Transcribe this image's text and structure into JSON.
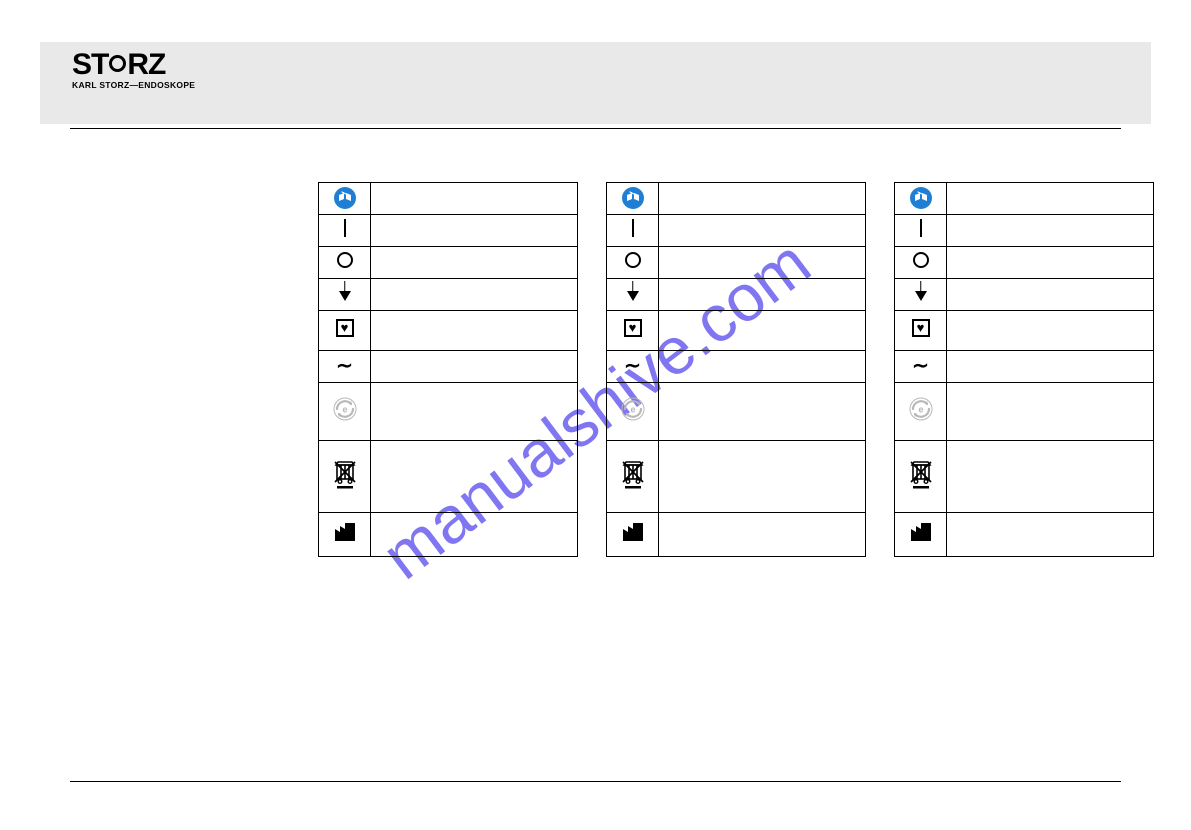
{
  "header": {
    "brand_name": "STORZ",
    "brand_tagline": "KARL STORZ—ENDOSKOPE"
  },
  "watermark": {
    "text": "manualshive.com"
  },
  "tables": [
    {
      "rows": [
        {
          "icon": "read-manual-icon",
          "desc": ""
        },
        {
          "icon": "power-on-icon",
          "desc": ""
        },
        {
          "icon": "power-off-icon",
          "desc": ""
        },
        {
          "icon": "equipotential-icon",
          "desc": ""
        },
        {
          "icon": "type-cf-icon",
          "desc": ""
        },
        {
          "icon": "ac-icon",
          "desc": ""
        },
        {
          "icon": "e-recycle-icon",
          "desc": ""
        },
        {
          "icon": "weee-bin-icon",
          "desc": ""
        },
        {
          "icon": "manufacturer-icon",
          "desc": ""
        }
      ]
    },
    {
      "rows": [
        {
          "icon": "read-manual-icon",
          "desc": ""
        },
        {
          "icon": "power-on-icon",
          "desc": ""
        },
        {
          "icon": "power-off-icon",
          "desc": ""
        },
        {
          "icon": "equipotential-icon",
          "desc": ""
        },
        {
          "icon": "type-cf-icon",
          "desc": ""
        },
        {
          "icon": "ac-icon",
          "desc": ""
        },
        {
          "icon": "e-recycle-icon",
          "desc": ""
        },
        {
          "icon": "weee-bin-icon",
          "desc": ""
        },
        {
          "icon": "manufacturer-icon",
          "desc": ""
        }
      ]
    },
    {
      "rows": [
        {
          "icon": "read-manual-icon",
          "desc": ""
        },
        {
          "icon": "power-on-icon",
          "desc": ""
        },
        {
          "icon": "power-off-icon",
          "desc": ""
        },
        {
          "icon": "equipotential-icon",
          "desc": ""
        },
        {
          "icon": "type-cf-icon",
          "desc": ""
        },
        {
          "icon": "ac-icon",
          "desc": ""
        },
        {
          "icon": "e-recycle-icon",
          "desc": ""
        },
        {
          "icon": "weee-bin-icon",
          "desc": ""
        },
        {
          "icon": "manufacturer-icon",
          "desc": ""
        }
      ]
    }
  ]
}
